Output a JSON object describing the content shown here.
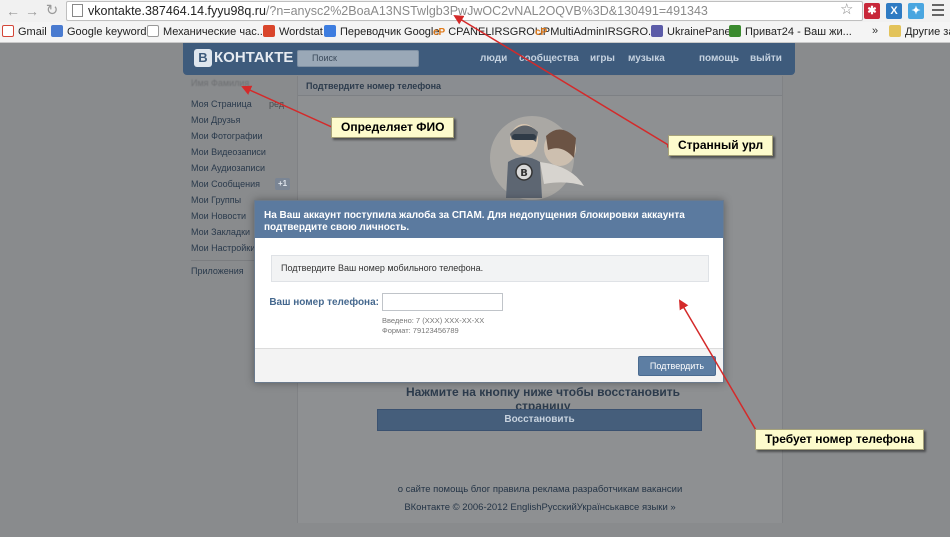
{
  "browser": {
    "url_host": "vkontakte.387464.14.fyyu98q.ru",
    "url_path": "/?n=anysc2%2BoaA13NSTwlgb3PwJwOC2vNAL2OQVB%3D&130491=491343",
    "bookmarks": [
      {
        "label": "Gmail",
        "color": "#d44638"
      },
      {
        "label": "Google keywords",
        "color": "#4a7bd0"
      },
      {
        "label": "Механические час...",
        "color": "#cfcfcf"
      },
      {
        "label": "Wordstat",
        "color": "#d9452b"
      },
      {
        "label": "Переводчик Google",
        "color": "#3d7de0"
      },
      {
        "label": "CPANELIRSGROUP",
        "prefix": "cP"
      },
      {
        "label": "MultiAdminIRSGRO...",
        "prefix": "cP"
      },
      {
        "label": "UkrainePanel",
        "color": "#5c5ca8"
      },
      {
        "label": "Приват24 - Ваш жи...",
        "color": "#3a8a2e"
      }
    ],
    "more_label": "»",
    "other_bookmarks": "Другие закладки"
  },
  "vk": {
    "logo": "КОНТАКТЕ",
    "logo_letter": "В",
    "search_placeholder": "Поиск",
    "nav": [
      "люди",
      "сообщества",
      "игры",
      "музыка",
      "помощь",
      "выйти"
    ],
    "user_name": "Имя Фамилия",
    "menu": [
      "Моя Страница",
      "Мои Друзья",
      "Мои Фотографии",
      "Мои Видеозаписи",
      "Мои Аудиозаписи",
      "Мои Сообщения",
      "Мои Группы",
      "Мои Новости",
      "Мои Закладки",
      "Мои Настройки"
    ],
    "menu_edit": "ред.",
    "messages_badge": "+1",
    "apps": "Приложения",
    "content_title": "Подтвердите номер телефона",
    "restore_text": "Нажмите на кнопку ниже чтобы восстановить страницу",
    "restore_button": "Восстановить",
    "footer_links": "о сайте помощь блог правила реклама разработчикам вакансии",
    "footer_copy": "ВКонтакте © 2006-2012 EnglishРусскийУкраїнськавсе языки »"
  },
  "modal": {
    "title": "На Ваш аккаунт поступила жалоба за СПАМ. Для недопущения блокировки аккаунта подтвердите свою личность.",
    "info": "Подтвердите Ваш номер мобильного телефона.",
    "phone_label": "Ваш номер телефона:",
    "phone_value": "",
    "hint_entered": "Введено: 7 (XXX) XXX-XX-XX",
    "hint_format": "Формат: 79123456789",
    "confirm_button": "Подтвердить"
  },
  "annotations": {
    "fio": "Определяет ФИО",
    "url": "Странный  урл",
    "phone": "Требует номер телефона"
  },
  "colors": {
    "arrow": "#d42a2a",
    "vk_header": "#3e5b7c",
    "modal_header": "#5b7a9f",
    "callout_bg": "#fdfbcc"
  }
}
